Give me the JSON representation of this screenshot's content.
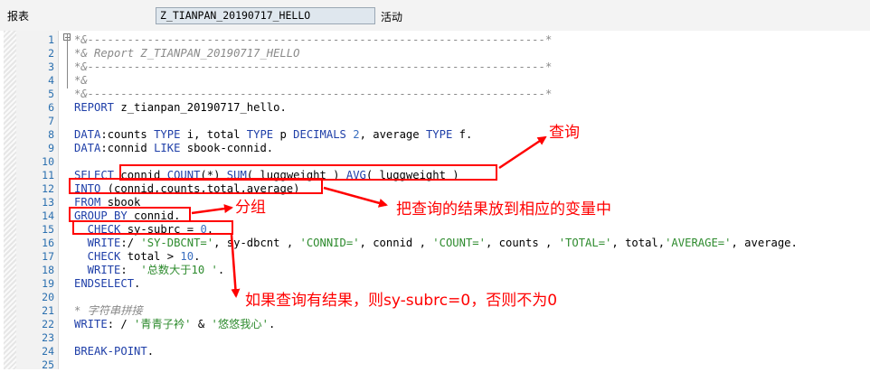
{
  "header": {
    "report_label": "报表",
    "program_name": "Z_TIANPAN_20190717_HELLO",
    "status": "活动"
  },
  "lines": [
    {
      "n": "1"
    },
    {
      "n": "2"
    },
    {
      "n": "3"
    },
    {
      "n": "4"
    },
    {
      "n": "5"
    },
    {
      "n": "6"
    },
    {
      "n": "7"
    },
    {
      "n": "8"
    },
    {
      "n": "9"
    },
    {
      "n": "10"
    },
    {
      "n": "11"
    },
    {
      "n": "12"
    },
    {
      "n": "13"
    },
    {
      "n": "14"
    },
    {
      "n": "15"
    },
    {
      "n": "16"
    },
    {
      "n": "17"
    },
    {
      "n": "18"
    },
    {
      "n": "19"
    },
    {
      "n": "20"
    },
    {
      "n": "21"
    },
    {
      "n": "22"
    },
    {
      "n": "23"
    },
    {
      "n": "24"
    },
    {
      "n": "25"
    }
  ],
  "code": {
    "l1": "*&---------------------------------------------------------------------*",
    "l2": "*& Report Z_TIANPAN_20190717_HELLO",
    "l3": "*&---------------------------------------------------------------------*",
    "l4": "*&",
    "l5": "*&---------------------------------------------------------------------*",
    "l6_kw": "REPORT",
    "l6_rest": " z_tianpan_20190717_hello.",
    "l8_a": "DATA",
    "l8_b": ":counts ",
    "l8_c": "TYPE",
    "l8_d": " i, total ",
    "l8_e": "TYPE",
    "l8_f": " p ",
    "l8_g": "DECIMALS",
    "l8_h": " ",
    "l8_i": "2",
    "l8_j": ", average ",
    "l8_k": "TYPE",
    "l8_l": " f.",
    "l9_a": "DATA",
    "l9_b": ":connid ",
    "l9_c": "LIKE",
    "l9_d": " sbook-connid.",
    "l11_a": "SELECT",
    "l11_b": " connid ",
    "l11_c": "COUNT",
    "l11_d": "(*) ",
    "l11_e": "SUM",
    "l11_f": "( luggweight ) ",
    "l11_g": "AVG",
    "l11_h": "( luggweight )",
    "l12_a": "INTO",
    "l12_b": " (connid,counts,total,average)",
    "l13_a": "FROM",
    "l13_b": " sbook",
    "l14_a": "GROUP BY",
    "l14_b": " connid.",
    "l15_a": "  CHECK",
    "l15_b": " sy-subrc = ",
    "l15_c": "0",
    "l15_d": ".",
    "l16_a": "  WRITE",
    "l16_b": ":/ ",
    "l16_c": "'SY-DBCNT='",
    "l16_d": ", sy-dbcnt , ",
    "l16_e": "'CONNID='",
    "l16_f": ", connid , ",
    "l16_g": "'COUNT='",
    "l16_h": ", counts , ",
    "l16_i": "'TOTAL='",
    "l16_j": ", total,",
    "l16_k": "'AVERAGE='",
    "l16_l": ", average.",
    "l17_a": "  CHECK",
    "l17_b": " total > ",
    "l17_c": "10",
    "l17_d": ".",
    "l18_a": "  WRITE",
    "l18_b": ":  ",
    "l18_c": "'总数大于10 '",
    "l18_d": ".",
    "l19_a": "ENDSELECT",
    "l19_b": ".",
    "l21": "* 字符串拼接",
    "l22_a": "WRITE",
    "l22_b": ": / ",
    "l22_c": "'青青子衿'",
    "l22_d": " & ",
    "l22_e": "'悠悠我心'",
    "l22_f": ".",
    "l24_a": "BREAK-POINT",
    "l24_b": "."
  },
  "annotations": {
    "query": "查询",
    "into_result": "把查询的结果放到相应的变量中",
    "group": "分组",
    "subrc": "如果查询有结果，则sy-subrc=0，否则不为0"
  },
  "colors": {
    "annotation": "#ff0000",
    "keyword": "#1f3fa8",
    "string": "#2e8b2e",
    "comment": "#8a8a8a",
    "line_number": "#2a6faf"
  }
}
